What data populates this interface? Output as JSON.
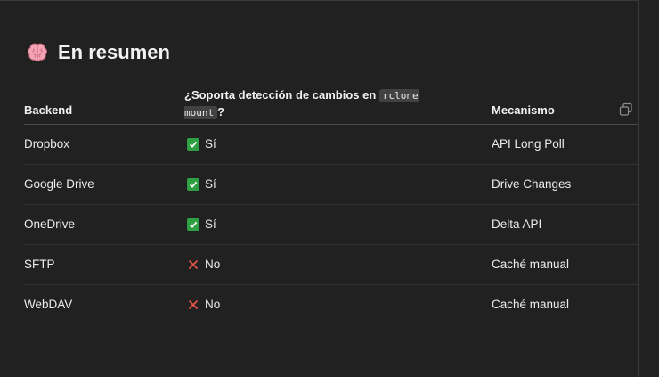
{
  "section": {
    "heading_icon": "brain-icon",
    "heading": "En resumen"
  },
  "table": {
    "headers": {
      "backend": "Backend",
      "support_prefix": "¿Soporta detección de cambios en ",
      "support_code": "rclone mount",
      "support_suffix": "?",
      "mechanism": "Mecanismo"
    },
    "copy_icon": "copy-icon",
    "rows": [
      {
        "backend": "Dropbox",
        "icon": "check-icon",
        "support": "Sí",
        "mechanism": "API Long Poll"
      },
      {
        "backend": "Google Drive",
        "icon": "check-icon",
        "support": "Sí",
        "mechanism": "Drive Changes"
      },
      {
        "backend": "OneDrive",
        "icon": "check-icon",
        "support": "Sí",
        "mechanism": "Delta API"
      },
      {
        "backend": "SFTP",
        "icon": "cross-icon",
        "support": "No",
        "mechanism": "Caché manual"
      },
      {
        "backend": "WebDAV",
        "icon": "cross-icon",
        "support": "No",
        "mechanism": "Caché manual"
      }
    ]
  },
  "colors": {
    "background": "#212121",
    "check": "#2ea043",
    "cross": "#e5534b",
    "brain": "#f4a3b4"
  }
}
